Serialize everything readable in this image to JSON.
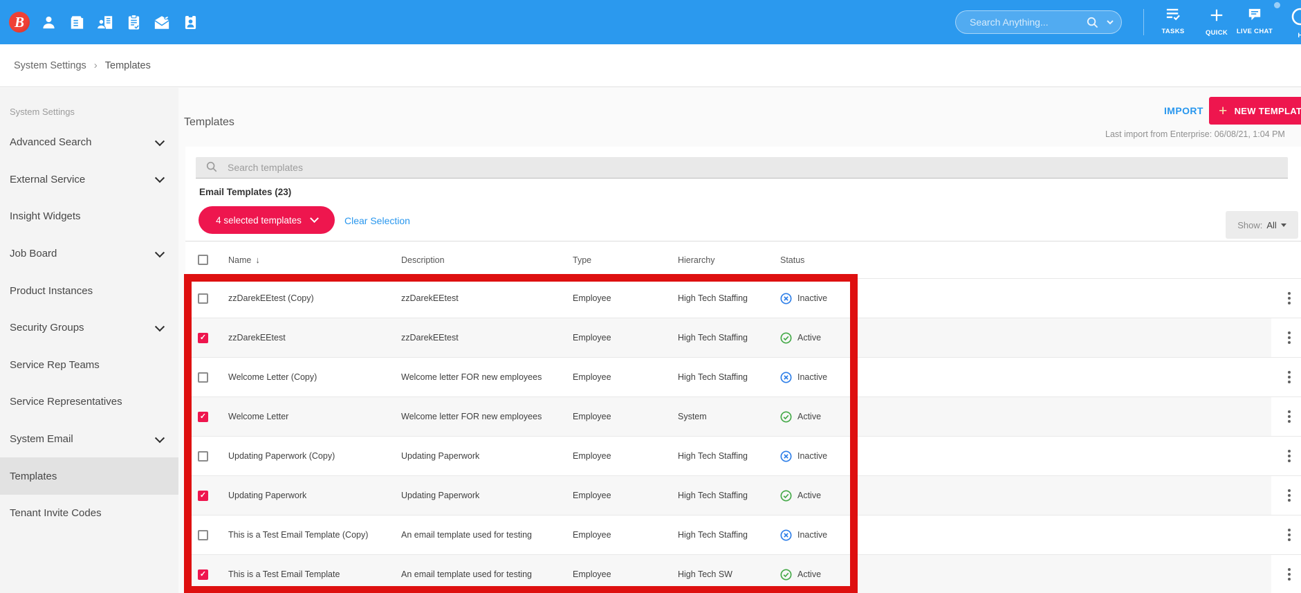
{
  "colors": {
    "navbar_blue": "#2B99EE",
    "accent_red": "#EE164E",
    "annotation_red": "#DE1010",
    "link_blue": "#2997EE",
    "active_green": "#44A948",
    "inactive_blue": "#2E7FE8"
  },
  "navbar": {
    "logo_letter": "B",
    "menu_icons": [
      {
        "name": "candidate-person-icon"
      },
      {
        "name": "company-icon"
      },
      {
        "name": "contact-company-icon"
      },
      {
        "name": "joborder-clipboard-icon"
      },
      {
        "name": "placement-mail-icon"
      },
      {
        "name": "idcard-icon"
      }
    ],
    "search": {
      "placeholder": "Search Anything..."
    },
    "actions": [
      {
        "label": "TASKS",
        "icon": "tasks-icon"
      },
      {
        "label": "QUICK",
        "icon": "plus-icon"
      },
      {
        "label": "LIVE CHAT",
        "icon": "chat-icon"
      },
      {
        "label": "H",
        "icon": "help-icon"
      }
    ]
  },
  "breadcrumb": {
    "items": [
      "System Settings",
      "Templates"
    ]
  },
  "sidebar": {
    "header": "System Settings",
    "items": [
      {
        "label": "Advanced Search",
        "chevron": true,
        "selected": false
      },
      {
        "label": "External Service",
        "chevron": true,
        "selected": false
      },
      {
        "label": "Insight Widgets",
        "chevron": false,
        "selected": false
      },
      {
        "label": "Job Board",
        "chevron": true,
        "selected": false
      },
      {
        "label": "Product Instances",
        "chevron": false,
        "selected": false
      },
      {
        "label": "Security Groups",
        "chevron": true,
        "selected": false
      },
      {
        "label": "Service Rep Teams",
        "chevron": false,
        "selected": false
      },
      {
        "label": "Service Representatives",
        "chevron": false,
        "selected": false
      },
      {
        "label": "System Email",
        "chevron": true,
        "selected": false
      },
      {
        "label": "Templates",
        "chevron": false,
        "selected": true
      },
      {
        "label": "Tenant Invite Codes",
        "chevron": false,
        "selected": false
      }
    ]
  },
  "main": {
    "title": "Templates",
    "import_label": "IMPORT",
    "new_template_label": "NEW TEMPLATE",
    "last_import": "Last import from Enterprise: 06/08/21, 1:04 PM",
    "search_placeholder": "Search templates",
    "section_label": "Email Templates (23)",
    "selection_pill": "4 selected templates",
    "clear_selection": "Clear Selection",
    "show_label": "Show:",
    "show_value": "All"
  },
  "table": {
    "headers": [
      "Name",
      "Description",
      "Type",
      "Hierarchy",
      "Status"
    ],
    "sort": {
      "column": "Name",
      "direction": "desc"
    },
    "rows": [
      {
        "checked": false,
        "name": "zzDarekEEtest (Copy)",
        "description": "zzDarekEEtest",
        "type": "Employee",
        "hierarchy": "High Tech Staffing",
        "status": "Inactive"
      },
      {
        "checked": true,
        "name": "zzDarekEEtest",
        "description": "zzDarekEEtest",
        "type": "Employee",
        "hierarchy": "High Tech Staffing",
        "status": "Active"
      },
      {
        "checked": false,
        "name": "Welcome Letter (Copy)",
        "description": "Welcome letter FOR new employees",
        "type": "Employee",
        "hierarchy": "High Tech Staffing",
        "status": "Inactive"
      },
      {
        "checked": true,
        "name": "Welcome Letter",
        "description": "Welcome letter FOR new employees",
        "type": "Employee",
        "hierarchy": "System",
        "status": "Active"
      },
      {
        "checked": false,
        "name": "Updating Paperwork (Copy)",
        "description": "Updating Paperwork",
        "type": "Employee",
        "hierarchy": "High Tech Staffing",
        "status": "Inactive"
      },
      {
        "checked": true,
        "name": "Updating Paperwork",
        "description": "Updating Paperwork",
        "type": "Employee",
        "hierarchy": "High Tech Staffing",
        "status": "Active"
      },
      {
        "checked": false,
        "name": "This is a Test Email Template (Copy)",
        "description": "An email template used for testing",
        "type": "Employee",
        "hierarchy": "High Tech Staffing",
        "status": "Inactive"
      },
      {
        "checked": true,
        "name": "This is a Test Email Template",
        "description": "An email template used for testing",
        "type": "Employee",
        "hierarchy": "High Tech SW",
        "status": "Active"
      }
    ]
  },
  "annotation": {
    "type": "highlight-box",
    "color": "#DE1010"
  }
}
